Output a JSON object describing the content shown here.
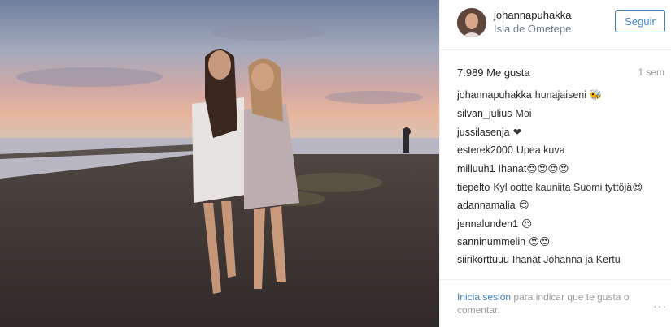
{
  "post": {
    "username": "johannapuhakka",
    "location": "Isla de Ometepe",
    "follow_label": "Seguir",
    "likes": "7.989 Me gusta",
    "time": "1 sem",
    "comments": [
      {
        "author": "johannapuhakka",
        "text": "hunajaiseni 🐝"
      },
      {
        "author": "silvan_julius",
        "text": "Moi"
      },
      {
        "author": "jussilasenja",
        "text": "❤"
      },
      {
        "author": "esterek2000",
        "text": "Upea kuva"
      },
      {
        "author": "milluuh1",
        "text": "Ihanat😍😍😍😍"
      },
      {
        "author": "tiepelto",
        "text": "Kyl ootte kauniita Suomi tyttöjä😍"
      },
      {
        "author": "adannamalia",
        "text": "😍"
      },
      {
        "author": "jennalunden1",
        "text": "😍"
      },
      {
        "author": "sanninummelin",
        "text": "😍😍"
      },
      {
        "author": "siirikorttuuu",
        "text": "Ihanat Johanna ja Kertu"
      }
    ],
    "footer": {
      "login_link": "Inicia sesión",
      "login_text": "para indicar que te gusta o comentar."
    },
    "more_label": "···"
  }
}
